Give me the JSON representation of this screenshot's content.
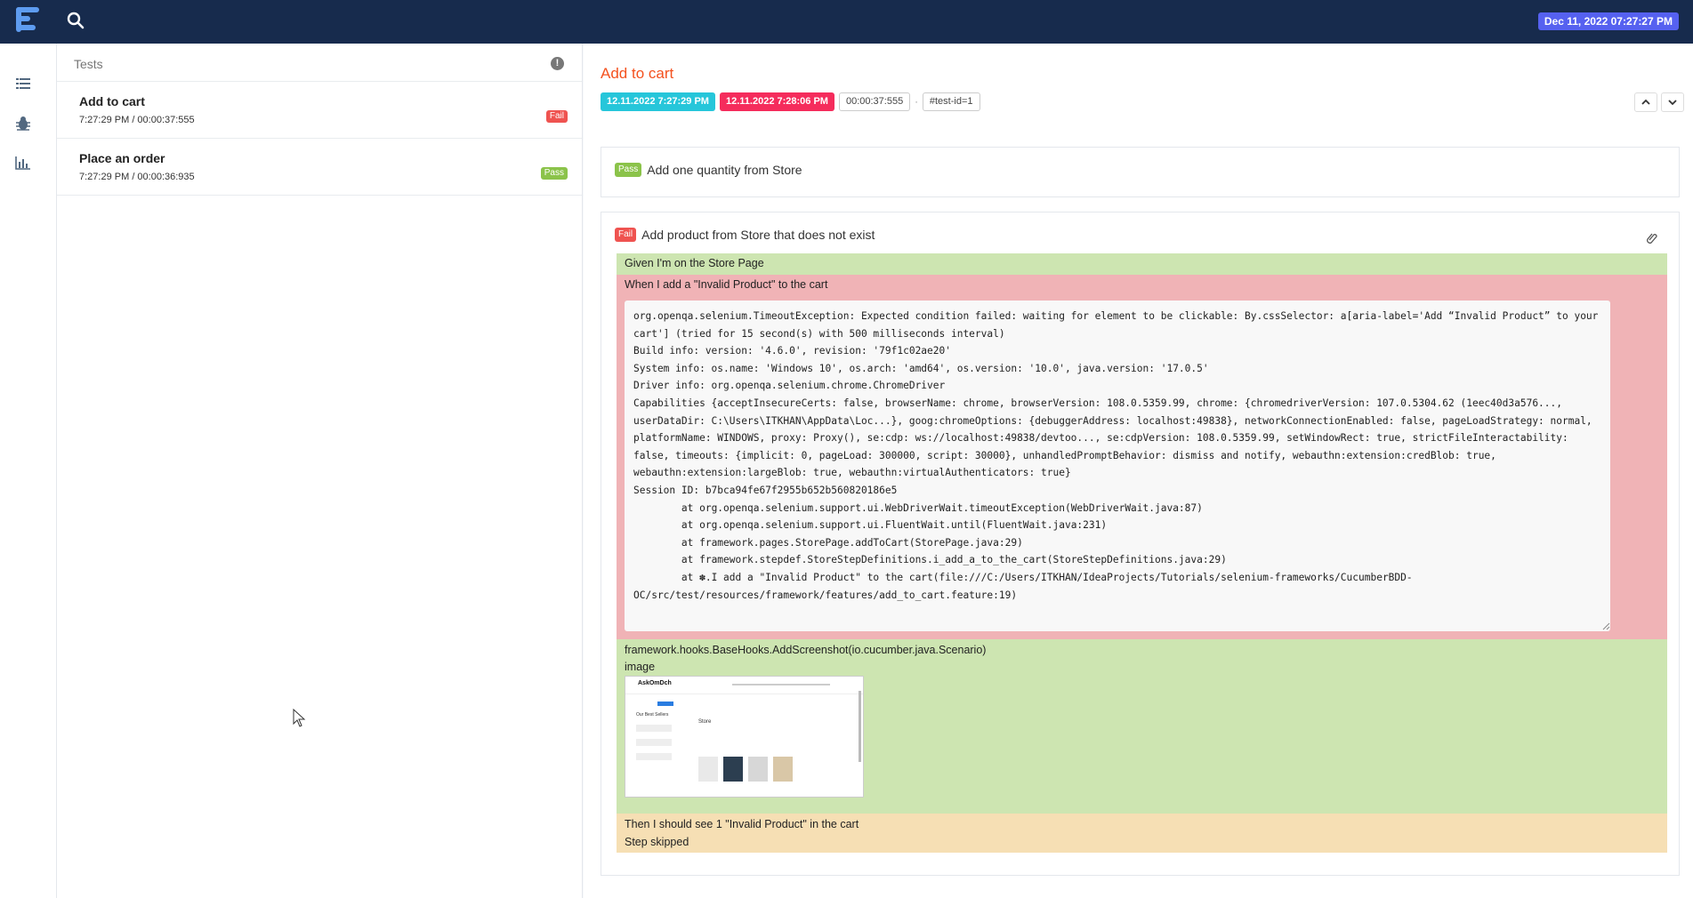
{
  "header": {
    "datetime": "Dec 11, 2022 07:27:27 PM"
  },
  "sidebar": {
    "icons": [
      "list-icon",
      "bug-icon",
      "bar-chart-icon"
    ]
  },
  "tests_panel": {
    "title": "Tests",
    "items": [
      {
        "name": "Add to cart",
        "meta": "7:27:29 PM / 00:00:37:555",
        "status": "Fail"
      },
      {
        "name": "Place an order",
        "meta": "7:27:29 PM / 00:00:36:935",
        "status": "Pass"
      }
    ]
  },
  "detail": {
    "title": "Add to cart",
    "start": "12.11.2022 7:27:29 PM",
    "end": "12.11.2022 7:28:06 PM",
    "duration": "00:00:37:555",
    "separator": "·",
    "test_id": "#test-id=1",
    "scenarios": [
      {
        "status": "Pass",
        "name": "Add one quantity from Store"
      },
      {
        "status": "Fail",
        "name": "Add product from Store that does not exist",
        "steps": {
          "given": "Given I'm on the Store Page",
          "when": "When I add a \"Invalid Product\" to the cart",
          "error": "org.openqa.selenium.TimeoutException: Expected condition failed: waiting for element to be clickable: By.cssSelector: a[aria-label='Add “Invalid Product” to your cart'] (tried for 15 second(s) with 500 milliseconds interval)\nBuild info: version: '4.6.0', revision: '79f1c02ae20'\nSystem info: os.name: 'Windows 10', os.arch: 'amd64', os.version: '10.0', java.version: '17.0.5'\nDriver info: org.openqa.selenium.chrome.ChromeDriver\nCapabilities {acceptInsecureCerts: false, browserName: chrome, browserVersion: 108.0.5359.99, chrome: {chromedriverVersion: 107.0.5304.62 (1eec40d3a576..., userDataDir: C:\\Users\\ITKHAN\\AppData\\Loc...}, goog:chromeOptions: {debuggerAddress: localhost:49838}, networkConnectionEnabled: false, pageLoadStrategy: normal, platformName: WINDOWS, proxy: Proxy(), se:cdp: ws://localhost:49838/devtoo..., se:cdpVersion: 108.0.5359.99, setWindowRect: true, strictFileInteractability: false, timeouts: {implicit: 0, pageLoad: 300000, script: 30000}, unhandledPromptBehavior: dismiss and notify, webauthn:extension:credBlob: true, webauthn:extension:largeBlob: true, webauthn:virtualAuthenticators: true}\nSession ID: b7bca94fe67f2955b652b560820186e5\n        at org.openqa.selenium.support.ui.WebDriverWait.timeoutException(WebDriverWait.java:87)\n        at org.openqa.selenium.support.ui.FluentWait.until(FluentWait.java:231)\n        at framework.pages.StorePage.addToCart(StorePage.java:29)\n        at framework.stepdef.StoreStepDefinitions.i_add_a_to_the_cart(StoreStepDefinitions.java:29)\n        at ✽.I add a \"Invalid Product\" to the cart(file:///C:/Users/ITKHAN/IdeaProjects/Tutorials/selenium-frameworks/CucumberBDD-OC/src/test/resources/framework/features/add_to_cart.feature:19)",
          "hook": "framework.hooks.BaseHooks.AddScreenshot(io.cucumber.java.Scenario)",
          "hook_label": "image",
          "then": "Then I should see 1 \"Invalid Product\" in the cart",
          "then_status": "Step skipped"
        },
        "screenshot": {
          "brand": "AskOmDch",
          "heading": "Store",
          "sidebar_title": "Our Best Sellers"
        }
      }
    ]
  },
  "colors": {
    "topbar": "#172b4d",
    "date_badge": "#5661f0",
    "title": "#f4511e",
    "fail": "#ef5350",
    "pass": "#8bc34a",
    "start_tag": "#26c6da",
    "end_tag": "#f52c5c",
    "step_pass": "#cde5b1",
    "step_fail": "#f0b3b6",
    "step_skip": "#f6dfb4"
  }
}
